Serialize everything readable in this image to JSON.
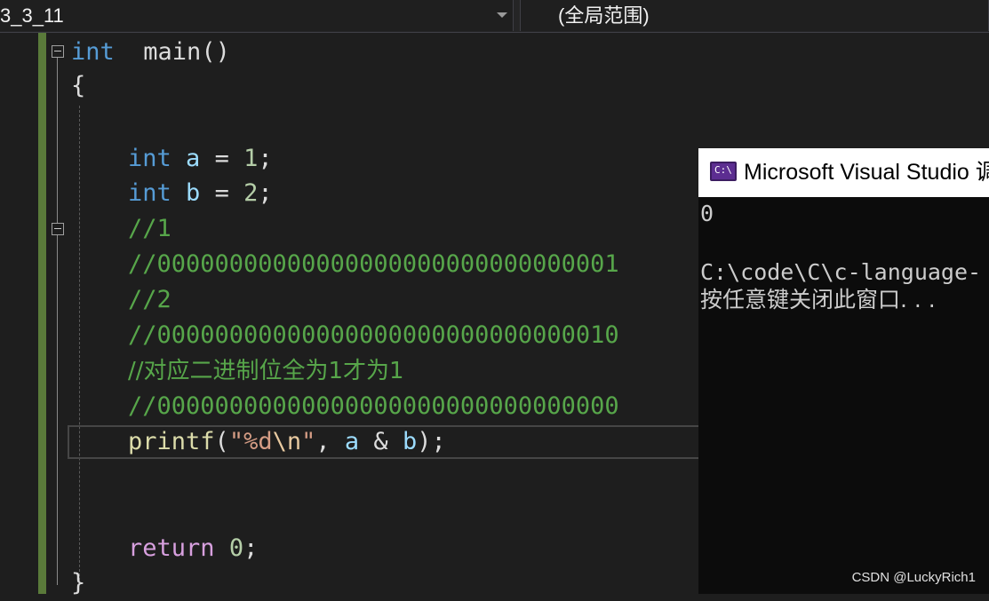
{
  "nav": {
    "project_combo": "3_3_11",
    "scope_combo": "(全局范围)"
  },
  "code": {
    "l1": {
      "kw": "int",
      "rest": "  main()"
    },
    "l2": "{",
    "l5": {
      "kw": "int",
      "var": "a",
      "op": " = ",
      "num": "1",
      "end": ";"
    },
    "l6": {
      "kw": "int",
      "var": "b",
      "op": " = ",
      "num": "2",
      "end": ";"
    },
    "l7": "//1",
    "l8": "//00000000000000000000000000000001",
    "l9": "//2",
    "l10": "//00000000000000000000000000000010",
    "l11": "//对应二进制位全为1才为1",
    "l12": "//00000000000000000000000000000000",
    "l13": {
      "fn": "printf",
      "open": "(",
      "str1": "\"%d",
      "esc": "\\n",
      "str2": "\"",
      "comma": ", ",
      "a": "a",
      "amp": " & ",
      "b": "b",
      "close": ");"
    },
    "l16": {
      "ctl": "return",
      "sp": " ",
      "num": "0",
      "end": ";"
    },
    "l17": "}"
  },
  "console": {
    "title": "Microsoft Visual Studio 调试控制台",
    "output_1": "0",
    "output_2": "C:\\code\\C\\c-language-",
    "output_3": "按任意键关闭此窗口. . ."
  },
  "watermark": "CSDN @LuckyRich1"
}
